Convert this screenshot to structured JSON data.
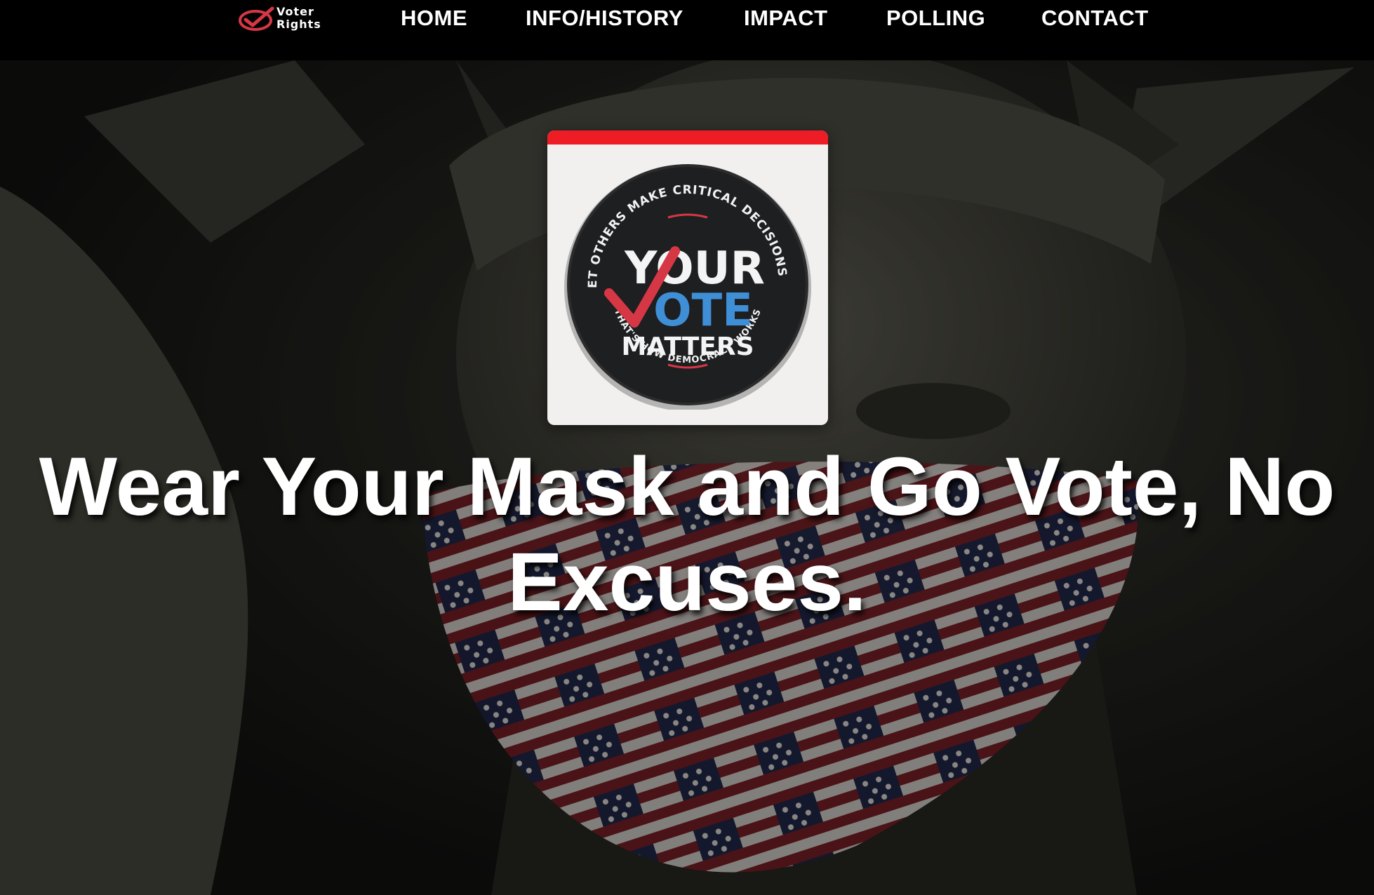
{
  "brand": {
    "line1": "Voter",
    "line2": "Rights"
  },
  "nav": {
    "items": [
      {
        "label": "HOME"
      },
      {
        "label": "INFO/HISTORY"
      },
      {
        "label": "IMPACT"
      },
      {
        "label": "POLLING"
      },
      {
        "label": "CONTACT"
      }
    ]
  },
  "badge": {
    "top_arc": "DON'T LET OTHERS MAKE CRITICAL DECISIONS FOR YOU",
    "bottom_arc": "THAT'S HOW DEMOCRACY WORKS",
    "line1": "YOUR",
    "line2": "OTE",
    "line3": "MATTERS"
  },
  "hero": {
    "headline": "Wear Your Mask and Go Vote, No Excuses."
  },
  "colors": {
    "accent_red": "#ee1c25",
    "badge_blue": "#3f8fd6",
    "check_red": "#d63745",
    "nav_bg": "#000000"
  }
}
